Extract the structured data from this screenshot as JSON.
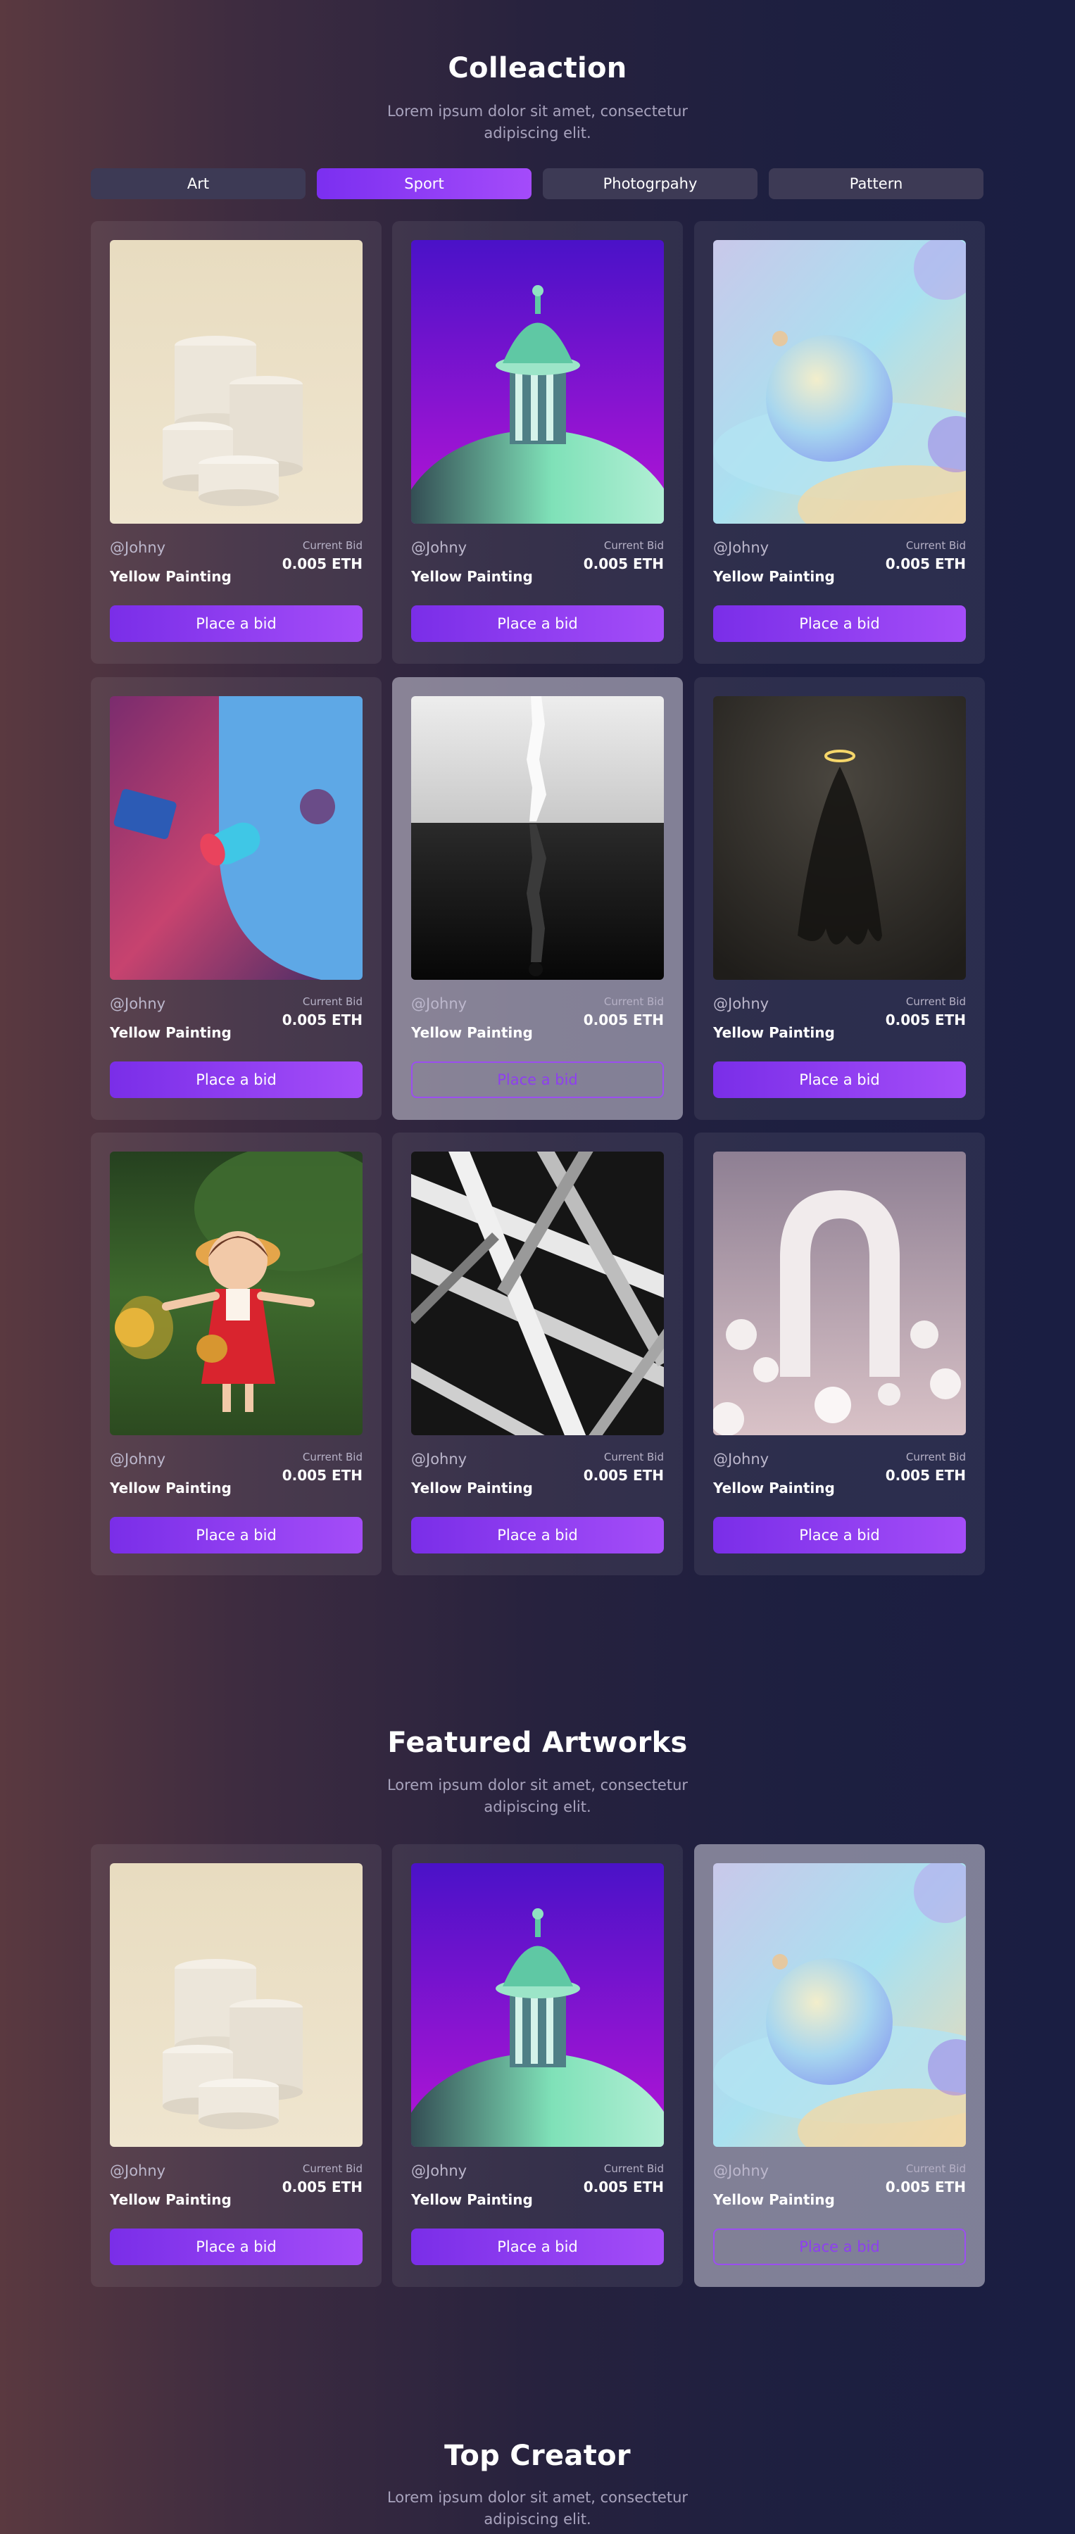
{
  "collection": {
    "title": "Colleaction",
    "subtitle": "Lorem ipsum dolor sit amet, consectetur adipiscing elit.",
    "tabs": [
      {
        "label": "Art",
        "active": false
      },
      {
        "label": "Sport",
        "active": true
      },
      {
        "label": "Photogrpahy",
        "active": false
      },
      {
        "label": "Pattern",
        "active": false
      }
    ],
    "cards": [
      {
        "image": "white-cylinders-image",
        "user": "@Johny",
        "title": "Yellow Painting",
        "bid_label": "Current Bid",
        "bid_value": "0.005 ETH",
        "button": "Place a bid",
        "highlighted": false
      },
      {
        "image": "purple-dome-image",
        "user": "@Johny",
        "title": "Yellow Painting",
        "bid_label": "Current Bid",
        "bid_value": "0.005 ETH",
        "button": "Place a bid",
        "highlighted": false
      },
      {
        "image": "pastel-sphere-image",
        "user": "@Johny",
        "title": "Yellow Painting",
        "bid_label": "Current Bid",
        "bid_value": "0.005 ETH",
        "button": "Place a bid",
        "highlighted": false
      },
      {
        "image": "abstract-shapes-image",
        "user": "@Johny",
        "title": "Yellow Painting",
        "bid_label": "Current Bid",
        "bid_value": "0.005 ETH",
        "button": "Place a bid",
        "highlighted": false
      },
      {
        "image": "statue-reflection-image",
        "user": "@Johny",
        "title": "Yellow Painting",
        "bid_label": "Current Bid",
        "bid_value": "0.005 ETH",
        "button": "Place a bid",
        "highlighted": true
      },
      {
        "image": "ghost-halo-image",
        "user": "@Johny",
        "title": "Yellow Painting",
        "bid_label": "Current Bid",
        "bid_value": "0.005 ETH",
        "button": "Place a bid",
        "highlighted": false
      },
      {
        "image": "doll-figure-image",
        "user": "@Johny",
        "title": "Yellow Painting",
        "bid_label": "Current Bid",
        "bid_value": "0.005 ETH",
        "button": "Place a bid",
        "highlighted": false
      },
      {
        "image": "bw-architecture-image",
        "user": "@Johny",
        "title": "Yellow Painting",
        "bid_label": "Current Bid",
        "bid_value": "0.005 ETH",
        "button": "Place a bid",
        "highlighted": false
      },
      {
        "image": "arch-spheres-image",
        "user": "@Johny",
        "title": "Yellow Painting",
        "bid_label": "Current Bid",
        "bid_value": "0.005 ETH",
        "button": "Place a bid",
        "highlighted": false
      }
    ]
  },
  "featured": {
    "title": "Featured Artworks",
    "subtitle": "Lorem ipsum dolor sit amet, consectetur adipiscing elit.",
    "cards": [
      {
        "image": "white-cylinders-image",
        "user": "@Johny",
        "title": "Yellow Painting",
        "bid_label": "Current Bid",
        "bid_value": "0.005 ETH",
        "button": "Place a bid",
        "highlighted": false
      },
      {
        "image": "purple-dome-image",
        "user": "@Johny",
        "title": "Yellow Painting",
        "bid_label": "Current Bid",
        "bid_value": "0.005 ETH",
        "button": "Place a bid",
        "highlighted": false
      },
      {
        "image": "pastel-sphere-image",
        "user": "@Johny",
        "title": "Yellow Painting",
        "bid_label": "Current Bid",
        "bid_value": "0.005 ETH",
        "button": "Place a bid",
        "highlighted": true
      }
    ]
  },
  "top_creator": {
    "title": "Top Creator",
    "subtitle": "Lorem ipsum dolor sit amet, consectetur adipiscing elit."
  },
  "colors": {
    "accent": "#8b3cf5",
    "accent_light": "#a44bfa",
    "tab_bg": "#3d3a55",
    "muted_text": "#a8a3bd"
  }
}
